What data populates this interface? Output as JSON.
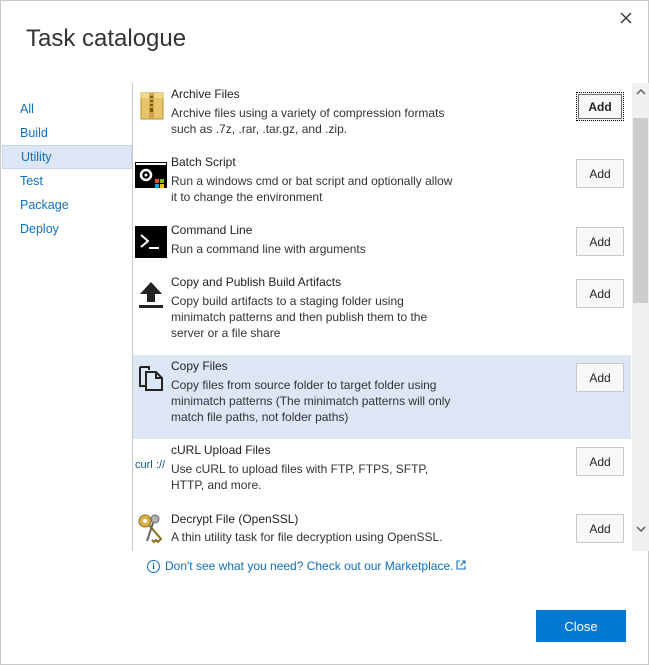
{
  "dialog": {
    "title": "Task catalogue",
    "close_button": "Close",
    "marketplace_link": "Don't see what you need? Check out our Marketplace."
  },
  "sidebar": {
    "items": [
      {
        "label": "All"
      },
      {
        "label": "Build"
      },
      {
        "label": "Utility"
      },
      {
        "label": "Test"
      },
      {
        "label": "Package"
      },
      {
        "label": "Deploy"
      }
    ],
    "selected": "Utility"
  },
  "tasks": [
    {
      "name": "Archive Files",
      "description": "Archive files using a variety of compression formats such as .7z, .rar, .tar.gz, and .zip.",
      "button": "Add",
      "icon": "archive-zip-icon"
    },
    {
      "name": "Batch Script",
      "description": "Run a windows cmd or bat script and optionally allow it to change the environment",
      "button": "Add",
      "icon": "batch-script-icon"
    },
    {
      "name": "Command Line",
      "description": "Run a command line with arguments",
      "button": "Add",
      "icon": "command-line-icon"
    },
    {
      "name": "Copy and Publish Build Artifacts",
      "description": "Copy build artifacts to a staging folder using minimatch patterns and then publish them to the server or a file share",
      "button": "Add",
      "icon": "upload-arrow-icon"
    },
    {
      "name": "Copy Files",
      "description": "Copy files from source folder to target folder using minimatch patterns (The minimatch patterns will only match file paths, not folder paths)",
      "button": "Add",
      "icon": "copy-files-icon"
    },
    {
      "name": "cURL Upload Files",
      "description": "Use cURL to upload files with FTP, FTPS, SFTP, HTTP, and more.",
      "button": "Add",
      "icon": "curl-icon"
    },
    {
      "name": "Decrypt File (OpenSSL)",
      "description": "A thin utility task for file decryption using OpenSSL.",
      "button": "Add",
      "icon": "keys-icon"
    }
  ],
  "colors": {
    "accent": "#0078d4",
    "link": "#106ebe",
    "selected_bg": "#dce6f4"
  }
}
